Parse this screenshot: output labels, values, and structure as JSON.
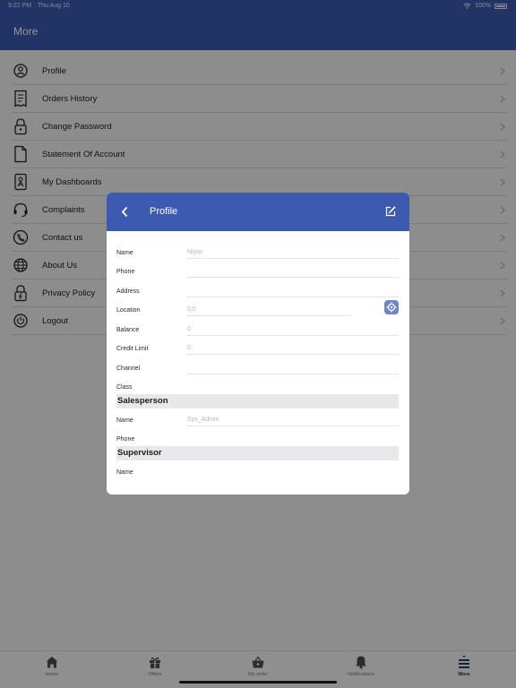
{
  "status_bar": {
    "time": "9:22 PM",
    "date": "Thu Aug 10",
    "battery": "100%"
  },
  "header": {
    "title": "More"
  },
  "menu": {
    "items": [
      {
        "label": "Profile",
        "icon": "user-circle-icon"
      },
      {
        "label": "Orders History",
        "icon": "receipt-icon"
      },
      {
        "label": "Change Password",
        "icon": "lock-icon"
      },
      {
        "label": "Statement Of Account",
        "icon": "document-icon"
      },
      {
        "label": "My Dashboards",
        "icon": "dashboard-doc-icon"
      },
      {
        "label": "Complaints",
        "icon": "headset-icon"
      },
      {
        "label": "Contact us",
        "icon": "phone-icon"
      },
      {
        "label": "About Us",
        "icon": "globe-icon"
      },
      {
        "label": "Privacy Policy",
        "icon": "privacy-lock-icon"
      },
      {
        "label": "Logout",
        "icon": "power-icon"
      }
    ]
  },
  "tabs": [
    {
      "label": "Home",
      "icon": "home-icon"
    },
    {
      "label": "Offers",
      "icon": "gift-icon"
    },
    {
      "label": "My order",
      "icon": "basket-icon"
    },
    {
      "label": "Notifications",
      "icon": "bell-icon"
    },
    {
      "label": "More",
      "icon": "more-lines-icon",
      "active": true
    }
  ],
  "modal": {
    "title": "Profile",
    "fields": [
      {
        "label": "Name",
        "value": "Niyas"
      },
      {
        "label": "Phone",
        "value": ""
      },
      {
        "label": "Address",
        "value": ""
      },
      {
        "label": "Location",
        "value": "0,0"
      },
      {
        "label": "Balance",
        "value": "0"
      },
      {
        "label": "Credit Limit",
        "value": "0"
      },
      {
        "label": "Channel",
        "value": ""
      },
      {
        "label": "Class",
        "value": ""
      }
    ],
    "salesperson": {
      "title": "Salesperson",
      "fields": [
        {
          "label": "Name",
          "value": "Sys_Admin"
        },
        {
          "label": "Phone",
          "value": ""
        }
      ]
    },
    "supervisor": {
      "title": "Supervisor",
      "fields": [
        {
          "label": "Name",
          "value": ""
        }
      ]
    }
  },
  "colors": {
    "primary": "#3b5ab0",
    "overlay": "rgba(0,0,0,0.42)",
    "location_button": "#6c86c9"
  }
}
